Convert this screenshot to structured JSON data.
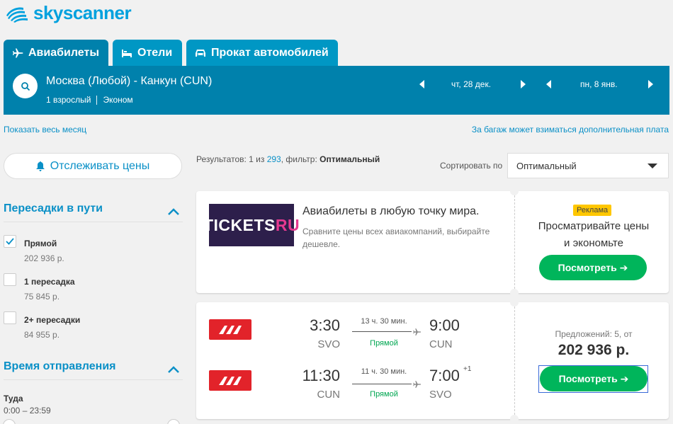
{
  "brand": {
    "name": "skyscanner",
    "color": "#00a1de"
  },
  "tabs": [
    {
      "label": "Авиабилеты",
      "icon": "plane-icon",
      "active": true
    },
    {
      "label": "Отели",
      "icon": "bed-icon",
      "active": false
    },
    {
      "label": "Прокат автомобилей",
      "icon": "car-icon",
      "active": false
    }
  ],
  "search": {
    "route": "Москва (Любой) - Канкун (CUN)",
    "passengers": "1 взрослый",
    "cabin": "Эконом",
    "depart_date": "чт, 28 дек.",
    "return_date": "пн, 8 янв."
  },
  "links": {
    "show_month": "Показать весь месяц",
    "baggage_note": "За багаж может взиматься дополнительная плата"
  },
  "sidebar": {
    "track_label": "Отслеживать цены",
    "stops_title": "Пересадки в пути",
    "stops": [
      {
        "label": "Прямой",
        "price": "202 936 р.",
        "checked": true
      },
      {
        "label": "1 пересадка",
        "price": "75 845 р.",
        "checked": false
      },
      {
        "label": "2+ пересадки",
        "price": "84 955 р.",
        "checked": false
      }
    ],
    "departure_title": "Время отправления",
    "outbound_label": "Туда",
    "outbound_range": "0:00 – 23:59"
  },
  "results": {
    "prefix": "Результатов: 1 из ",
    "total": "293",
    "filter_prefix": ", фильтр: ",
    "filter": "Оптимальный",
    "sort_label": "Сортировать по",
    "sort_value": "Оптимальный"
  },
  "ad": {
    "logo_main": "TICKETS",
    "logo_suffix": "RU",
    "title": "Авиабилеты в любую точку мира.",
    "description": "Сравните цены всех авиакомпаний, выбирайте дешевле.",
    "badge": "Реклама",
    "right_line1": "Просматривайте цены",
    "right_line2": "и экономьте",
    "button": "Посмотреть ➔"
  },
  "flight": {
    "legs": [
      {
        "dep_time": "3:30",
        "dep_airport": "SVO",
        "duration": "13 ч. 30 мин.",
        "stops": "Прямой",
        "arr_time": "9:00",
        "arr_airport": "CUN",
        "day_offset": ""
      },
      {
        "dep_time": "11:30",
        "dep_airport": "CUN",
        "duration": "11 ч. 30 мин.",
        "stops": "Прямой",
        "arr_time": "7:00",
        "arr_airport": "SVO",
        "day_offset": "+1"
      }
    ],
    "offers": "Предложений: 5, от",
    "price": "202 936 р.",
    "button": "Посмотреть ➔"
  },
  "colors": {
    "primary_dark": "#0081ac",
    "primary_tab": "#0097c4",
    "accent_green": "#00b55b",
    "airline_red": "#e2232a",
    "ad_badge": "#ffc700"
  }
}
